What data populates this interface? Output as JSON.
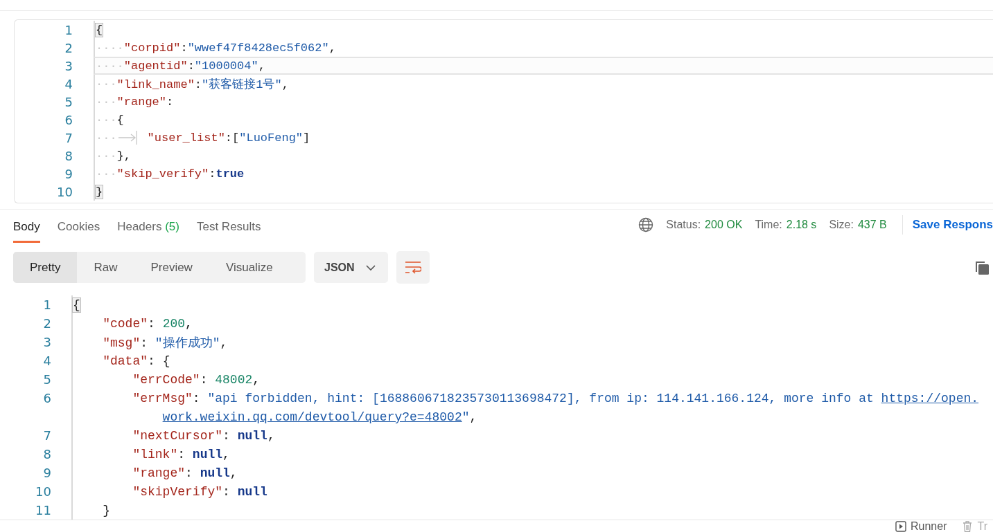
{
  "request_editor": {
    "lines": [
      {
        "num": "1",
        "tab": false,
        "active": false,
        "tokens": [
          {
            "kind": "brace",
            "s": "{"
          }
        ]
      },
      {
        "num": "2",
        "ws": "····",
        "tab": false,
        "active": false,
        "tokens": [
          {
            "kind": "key",
            "s": "\"corpid\""
          },
          {
            "kind": "p",
            "s": ":"
          },
          {
            "kind": "str",
            "s": "\"wwef47f8428ec5f062\""
          },
          {
            "kind": "p",
            "s": ","
          }
        ]
      },
      {
        "num": "3",
        "ws": "····",
        "tab": false,
        "active": true,
        "tokens": [
          {
            "kind": "key",
            "s": "\"agentid\""
          },
          {
            "kind": "p",
            "s": ":"
          },
          {
            "kind": "str",
            "s": "\"1000004\""
          },
          {
            "kind": "p",
            "s": ","
          }
        ]
      },
      {
        "num": "4",
        "ws": "···",
        "tab": false,
        "active": false,
        "tokens": [
          {
            "kind": "key",
            "s": "\"link_name\""
          },
          {
            "kind": "p",
            "s": ":"
          },
          {
            "kind": "str",
            "s": "\"获客链接1号\""
          },
          {
            "kind": "p",
            "s": ","
          }
        ]
      },
      {
        "num": "5",
        "ws": "···",
        "tab": false,
        "active": false,
        "tokens": [
          {
            "kind": "key",
            "s": "\"range\""
          },
          {
            "kind": "p",
            "s": ":"
          }
        ]
      },
      {
        "num": "6",
        "ws": "···",
        "tab": false,
        "active": false,
        "tokens": [
          {
            "kind": "p",
            "s": "{"
          }
        ]
      },
      {
        "num": "7",
        "ws": "···",
        "tab": true,
        "active": false,
        "tokens": [
          {
            "kind": "key",
            "s": "\"user_list\""
          },
          {
            "kind": "p",
            "s": ":["
          },
          {
            "kind": "str",
            "s": "\"LuoFeng\""
          },
          {
            "kind": "p",
            "s": "]"
          }
        ]
      },
      {
        "num": "8",
        "ws": "···",
        "tab": false,
        "active": false,
        "tokens": [
          {
            "kind": "p",
            "s": "},"
          }
        ]
      },
      {
        "num": "9",
        "ws": "···",
        "tab": false,
        "active": false,
        "tokens": [
          {
            "kind": "key",
            "s": "\"skip_verify\""
          },
          {
            "kind": "p",
            "s": ":"
          },
          {
            "kind": "kw",
            "s": "true"
          }
        ]
      },
      {
        "num": "10",
        "tab": false,
        "active": false,
        "tokens": [
          {
            "kind": "brace",
            "s": "}"
          }
        ]
      }
    ]
  },
  "response_tabs": [
    {
      "label": "Body",
      "selected": true
    },
    {
      "label": "Cookies",
      "selected": false
    },
    {
      "label": "Headers",
      "count": "(5)",
      "selected": false
    },
    {
      "label": "Test Results",
      "selected": false
    }
  ],
  "response_meta": {
    "status_label": "Status:",
    "status": "200 OK",
    "time_label": "Time:",
    "time": "2.18 s",
    "size_label": "Size:",
    "size": "437 B",
    "save_button": "Save Respons"
  },
  "view_modes": [
    {
      "label": "Pretty",
      "selected": true
    },
    {
      "label": "Raw",
      "selected": false
    },
    {
      "label": "Preview",
      "selected": false
    },
    {
      "label": "Visualize",
      "selected": false
    }
  ],
  "format_dropdown": {
    "value": "JSON"
  },
  "response_body": {
    "lines": [
      {
        "num": "1",
        "tokens": [
          {
            "kind": "brace",
            "s": "{"
          }
        ]
      },
      {
        "num": "2",
        "tokens": [
          {
            "kind": "key",
            "s": "    \"code\""
          },
          {
            "kind": "p",
            "s": ": "
          },
          {
            "kind": "num",
            "s": "200"
          },
          {
            "kind": "p",
            "s": ","
          }
        ]
      },
      {
        "num": "3",
        "tokens": [
          {
            "kind": "key",
            "s": "    \"msg\""
          },
          {
            "kind": "p",
            "s": ": "
          },
          {
            "kind": "str",
            "s": "\"操作成功\""
          },
          {
            "kind": "p",
            "s": ","
          }
        ]
      },
      {
        "num": "4",
        "tokens": [
          {
            "kind": "key",
            "s": "    \"data\""
          },
          {
            "kind": "p",
            "s": ": {"
          }
        ]
      },
      {
        "num": "5",
        "tokens": [
          {
            "kind": "key",
            "s": "        \"errCode\""
          },
          {
            "kind": "p",
            "s": ": "
          },
          {
            "kind": "num",
            "s": "48002"
          },
          {
            "kind": "p",
            "s": ","
          }
        ]
      },
      {
        "num": "6",
        "tokens": [
          {
            "kind": "key",
            "s": "        \"errMsg\""
          },
          {
            "kind": "p",
            "s": ": "
          },
          {
            "kind": "str",
            "s": "\"api forbidden, hint: [1688606718235730113698472], from ip: 114.141.166.124, more info at "
          },
          {
            "kind": "link",
            "s": "https://open."
          }
        ]
      },
      {
        "tokens": [
          {
            "kind": "link",
            "s": "work.weixin.qq.com/devtool/query?e=48002"
          },
          {
            "kind": "str",
            "s": "\""
          },
          {
            "kind": "p",
            "s": ","
          }
        ]
      },
      {
        "num": "7",
        "tokens": [
          {
            "kind": "key",
            "s": "        \"nextCursor\""
          },
          {
            "kind": "p",
            "s": ": "
          },
          {
            "kind": "kw",
            "s": "null"
          },
          {
            "kind": "p",
            "s": ","
          }
        ]
      },
      {
        "num": "8",
        "tokens": [
          {
            "kind": "key",
            "s": "        \"link\""
          },
          {
            "kind": "p",
            "s": ": "
          },
          {
            "kind": "kw",
            "s": "null"
          },
          {
            "kind": "p",
            "s": ","
          }
        ]
      },
      {
        "num": "9",
        "tokens": [
          {
            "kind": "key",
            "s": "        \"range\""
          },
          {
            "kind": "p",
            "s": ": "
          },
          {
            "kind": "kw",
            "s": "null"
          },
          {
            "kind": "p",
            "s": ","
          }
        ]
      },
      {
        "num": "10",
        "tokens": [
          {
            "kind": "key",
            "s": "        \"skipVerify\""
          },
          {
            "kind": "p",
            "s": ": "
          },
          {
            "kind": "kw",
            "s": "null"
          }
        ]
      },
      {
        "num": "11",
        "tokens": [
          {
            "kind": "p",
            "s": "    }"
          }
        ]
      }
    ]
  },
  "footer": [
    {
      "kind": "runner",
      "label": "Runner"
    },
    {
      "kind": "trash",
      "label": "Tr"
    }
  ]
}
